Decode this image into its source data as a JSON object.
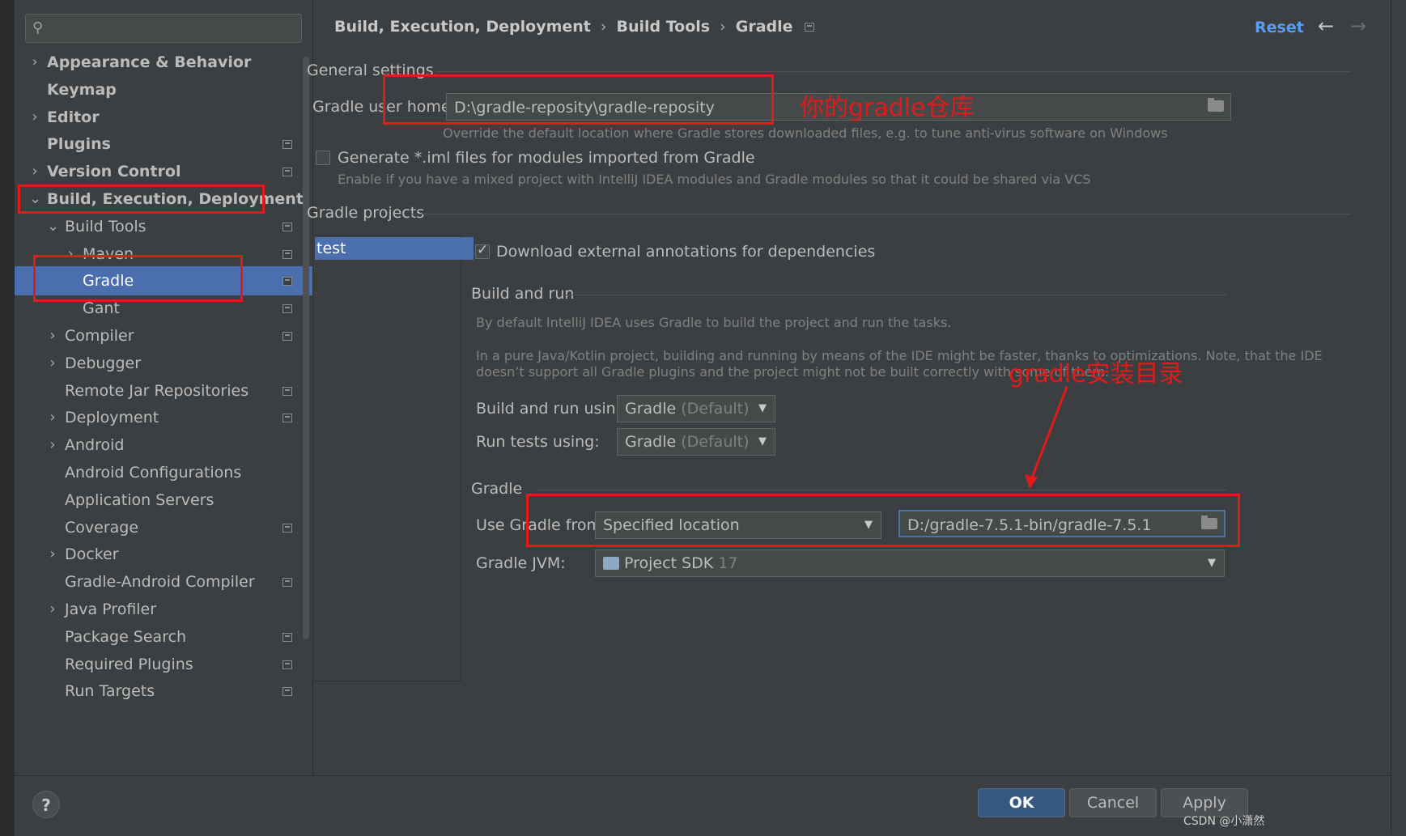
{
  "sidebar": {
    "search_placeholder": "",
    "items": [
      {
        "label": "Appearance & Behavior",
        "chev": "›",
        "indent": 0,
        "bold": true,
        "pm": false,
        "selected": false
      },
      {
        "label": "Keymap",
        "chev": "",
        "indent": 0,
        "bold": true,
        "pm": false,
        "selected": false
      },
      {
        "label": "Editor",
        "chev": "›",
        "indent": 0,
        "bold": true,
        "pm": false,
        "selected": false
      },
      {
        "label": "Plugins",
        "chev": "",
        "indent": 0,
        "bold": true,
        "pm": true,
        "selected": false
      },
      {
        "label": "Version Control",
        "chev": "›",
        "indent": 0,
        "bold": true,
        "pm": true,
        "selected": false
      },
      {
        "label": "Build, Execution, Deployment",
        "chev": "⌄",
        "indent": 0,
        "bold": true,
        "pm": false,
        "selected": false
      },
      {
        "label": "Build Tools",
        "chev": "⌄",
        "indent": 1,
        "bold": false,
        "pm": true,
        "selected": false
      },
      {
        "label": "Maven",
        "chev": "›",
        "indent": 2,
        "bold": false,
        "pm": true,
        "selected": false
      },
      {
        "label": "Gradle",
        "chev": "",
        "indent": 2,
        "bold": false,
        "pm": true,
        "selected": true
      },
      {
        "label": "Gant",
        "chev": "",
        "indent": 2,
        "bold": false,
        "pm": true,
        "selected": false
      },
      {
        "label": "Compiler",
        "chev": "›",
        "indent": 1,
        "bold": false,
        "pm": true,
        "selected": false
      },
      {
        "label": "Debugger",
        "chev": "›",
        "indent": 1,
        "bold": false,
        "pm": false,
        "selected": false
      },
      {
        "label": "Remote Jar Repositories",
        "chev": "",
        "indent": 1,
        "bold": false,
        "pm": true,
        "selected": false
      },
      {
        "label": "Deployment",
        "chev": "›",
        "indent": 1,
        "bold": false,
        "pm": true,
        "selected": false
      },
      {
        "label": "Android",
        "chev": "›",
        "indent": 1,
        "bold": false,
        "pm": false,
        "selected": false
      },
      {
        "label": "Android Configurations",
        "chev": "",
        "indent": 1,
        "bold": false,
        "pm": false,
        "selected": false
      },
      {
        "label": "Application Servers",
        "chev": "",
        "indent": 1,
        "bold": false,
        "pm": false,
        "selected": false
      },
      {
        "label": "Coverage",
        "chev": "",
        "indent": 1,
        "bold": false,
        "pm": true,
        "selected": false
      },
      {
        "label": "Docker",
        "chev": "›",
        "indent": 1,
        "bold": false,
        "pm": false,
        "selected": false
      },
      {
        "label": "Gradle-Android Compiler",
        "chev": "",
        "indent": 1,
        "bold": false,
        "pm": true,
        "selected": false
      },
      {
        "label": "Java Profiler",
        "chev": "›",
        "indent": 1,
        "bold": false,
        "pm": false,
        "selected": false
      },
      {
        "label": "Package Search",
        "chev": "",
        "indent": 1,
        "bold": false,
        "pm": true,
        "selected": false
      },
      {
        "label": "Required Plugins",
        "chev": "",
        "indent": 1,
        "bold": false,
        "pm": true,
        "selected": false
      },
      {
        "label": "Run Targets",
        "chev": "",
        "indent": 1,
        "bold": false,
        "pm": true,
        "selected": false
      }
    ]
  },
  "header": {
    "breadcrumb": [
      "Build, Execution, Deployment",
      "Build Tools",
      "Gradle"
    ],
    "breadcrumb_sep": "›",
    "reset": "Reset",
    "back": "←",
    "forward": "→"
  },
  "general": {
    "title": "General settings",
    "user_home_label": "Gradle user home:",
    "user_home_value": "D:\\gradle-reposity\\gradle-reposity",
    "user_home_hint": "Override the default location where Gradle stores downloaded files, e.g. to tune anti-virus software on Windows",
    "iml_label": "Generate *.iml files for modules imported from Gradle",
    "iml_hint": "Enable if you have a mixed project with IntelliJ IDEA modules and Gradle modules so that it could be shared via VCS",
    "iml_checked": false
  },
  "projects": {
    "title": "Gradle projects",
    "items": [
      "test"
    ],
    "download_annotations_label": "Download external annotations for dependencies",
    "download_annotations_checked": true
  },
  "build_run": {
    "title": "Build and run",
    "info1": "By default IntelliJ IDEA uses Gradle to build the project and run the tasks.",
    "info2": "In a pure Java/Kotlin project, building and running by means of the IDE might be faster, thanks to optimizations. Note, that the IDE",
    "info3": "doesn’t support all Gradle plugins and the project might not be built correctly with some of them.",
    "build_label": "Build and run using:",
    "build_value": "Gradle",
    "build_default": "(Default)",
    "tests_label": "Run tests using:",
    "tests_value": "Gradle",
    "tests_default": "(Default)"
  },
  "gradle": {
    "title": "Gradle",
    "use_from_label": "Use Gradle from:",
    "use_from_value": "Specified location",
    "location_value": "D:/gradle-7.5.1-bin/gradle-7.5.1",
    "jvm_label": "Gradle JVM:",
    "jvm_value": "Project SDK",
    "jvm_version": "17"
  },
  "annotations": {
    "repo_note": "你的gradle仓库",
    "install_note": "gradle安装目录"
  },
  "footer": {
    "help": "?",
    "ok": "OK",
    "cancel": "Cancel",
    "apply": "Apply",
    "watermark": "CSDN @小潇然"
  },
  "colors": {
    "background": "#3c3f41",
    "selection": "#4b6eaf",
    "link": "#589df6",
    "annotation_red": "#e11a1a",
    "ok_button": "#365880"
  }
}
